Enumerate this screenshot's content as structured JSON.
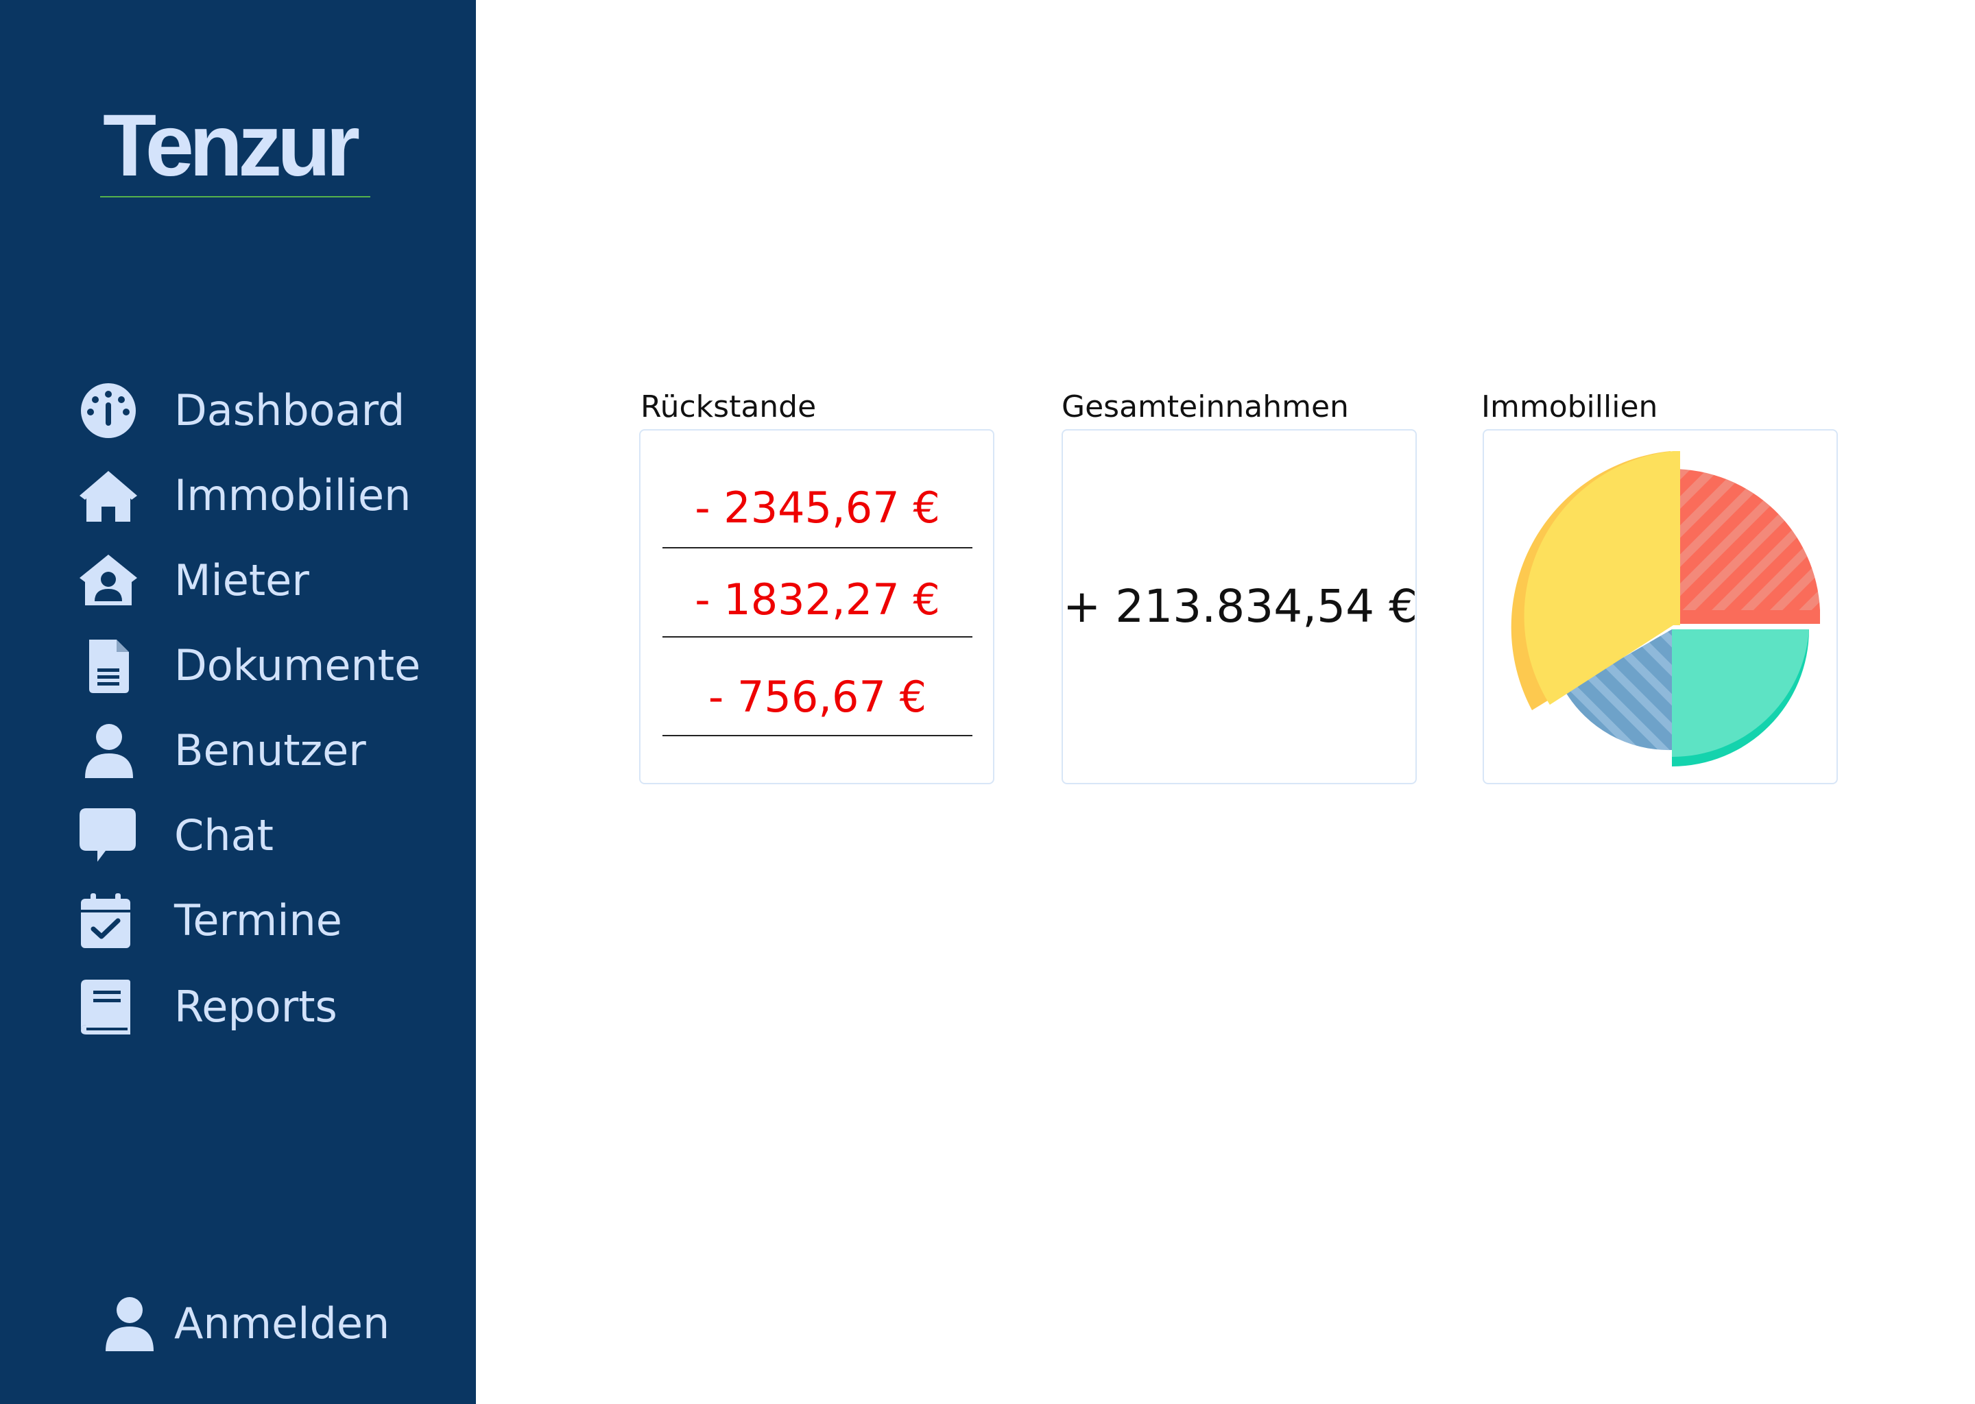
{
  "app": {
    "logo": "Tenzur"
  },
  "sidebar": {
    "items": [
      {
        "label": "Dashboard",
        "icon": "dashboard-icon"
      },
      {
        "label": "Immobilien",
        "icon": "home-icon"
      },
      {
        "label": "Mieter",
        "icon": "tenant-icon"
      },
      {
        "label": "Dokumente",
        "icon": "document-icon"
      },
      {
        "label": "Benutzer",
        "icon": "user-icon"
      },
      {
        "label": "Chat",
        "icon": "chat-icon"
      },
      {
        "label": "Termine",
        "icon": "calendar-check-icon"
      },
      {
        "label": "Reports",
        "icon": "book-icon"
      }
    ],
    "login": {
      "label": "Anmelden",
      "icon": "user-icon"
    }
  },
  "cards": {
    "arrears": {
      "title": "Rückstande",
      "values": [
        "- 2345,67 €",
        "- 1832,27 €",
        "- 756,67 €"
      ]
    },
    "income": {
      "title": "Gesamteinnahmen",
      "value": "+ 213.834,54 €"
    },
    "properties": {
      "title": "Immobillien",
      "icon": "pie-chart-icon"
    }
  },
  "colors": {
    "sidebar_bg": "#0a3662",
    "sidebar_text": "#d2e2fa",
    "logo_underline": "#55b24c",
    "negative": "#ee0000",
    "card_border": "#d8e6f7",
    "pie_yellow": "#fde05c",
    "pie_red": "#fa6c5a",
    "pie_green": "#5de3c4",
    "pie_blue": "#6ea2c9"
  }
}
